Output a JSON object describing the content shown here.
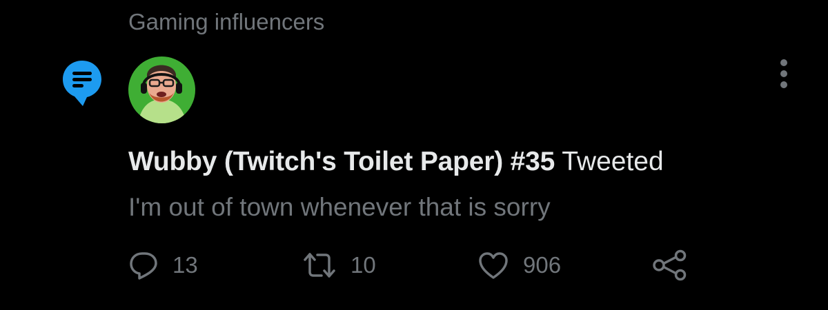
{
  "context": {
    "label": "Gaming influencers"
  },
  "tweet": {
    "author_name": "Wubby (Twitch's Toilet Paper) #35",
    "action_verb": "Tweeted",
    "text": "I'm out of town whenever that is sorry"
  },
  "actions": {
    "reply_count": "13",
    "retweet_count": "10",
    "like_count": "906"
  },
  "icons": {
    "topic": "topic-speech-bubble-icon",
    "more": "vertical-ellipsis-icon",
    "reply": "reply-bubble-icon",
    "retweet": "retweet-arrows-icon",
    "like": "heart-icon",
    "share": "share-nodes-icon"
  },
  "colors": {
    "background": "#000000",
    "primary_text": "#e7e9ea",
    "secondary_text": "#71767b",
    "topic_icon": "#1d9bf0",
    "avatar_background": "#3fae34"
  }
}
